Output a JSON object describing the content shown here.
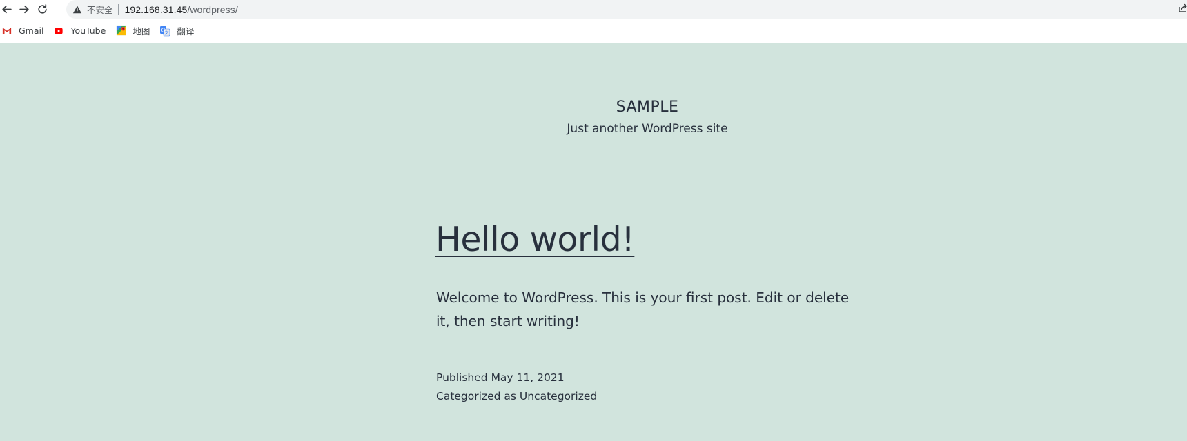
{
  "browser": {
    "security_label": "不安全",
    "url_host": "192.168.31.45",
    "url_path": "/wordpress/",
    "bookmarks": [
      {
        "label": "Gmail",
        "icon": "gmail-icon"
      },
      {
        "label": "YouTube",
        "icon": "youtube-icon"
      },
      {
        "label": "地图",
        "icon": "maps-icon"
      },
      {
        "label": "翻译",
        "icon": "translate-icon"
      }
    ]
  },
  "site": {
    "title": "SAMPLE",
    "tagline": "Just another WordPress site",
    "background_color": "#d1e4dd",
    "text_color": "#28303d"
  },
  "post": {
    "title": "Hello world!",
    "body": "Welcome to WordPress. This is your first post. Edit or delete it, then start writing!",
    "published_label": "Published",
    "published_date": "May 11, 2021",
    "categorized_label": "Categorized as",
    "category": "Uncategorized"
  }
}
